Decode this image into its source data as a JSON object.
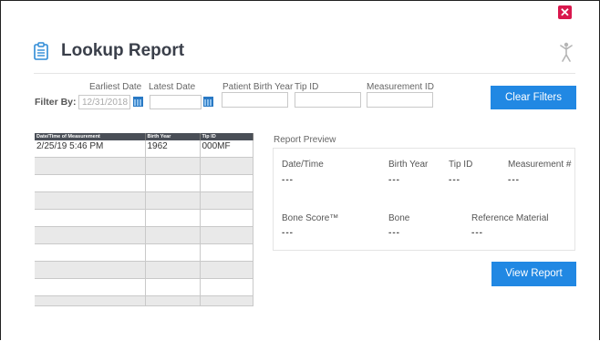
{
  "window": {
    "title": "Lookup Report",
    "close_glyph": "✕",
    "icons": [
      "clipboard-icon",
      "person-icon",
      "close-icon",
      "calendar-icon"
    ],
    "accent_color": "#2188e3",
    "close_color": "#d9184d"
  },
  "filters": {
    "filter_by_label": "Filter By:",
    "earliest_date": {
      "label": "Earliest Date",
      "value": "12/31/2018"
    },
    "latest_date": {
      "label": "Latest Date",
      "value": ""
    },
    "birth_year": {
      "label": "Patient Birth Year",
      "value": ""
    },
    "tip_id": {
      "label": "Tip ID",
      "value": ""
    },
    "measurement_id": {
      "label": "Measurement ID",
      "value": ""
    },
    "clear_label": "Clear Filters"
  },
  "table": {
    "columns": [
      "Date/Time of Measurement",
      "Birth Year",
      "Tip ID"
    ],
    "rows": [
      [
        "2/25/19 5:46 PM",
        "1962",
        "000MF"
      ],
      [
        "",
        "",
        ""
      ],
      [
        "",
        "",
        ""
      ],
      [
        "",
        "",
        ""
      ],
      [
        "",
        "",
        ""
      ],
      [
        "",
        "",
        ""
      ],
      [
        "",
        "",
        ""
      ],
      [
        "",
        "",
        ""
      ],
      [
        "",
        "",
        ""
      ],
      [
        "",
        "",
        ""
      ]
    ]
  },
  "preview": {
    "title": "Report Preview",
    "date_time": {
      "label": "Date/Time",
      "value": "---"
    },
    "birth_year": {
      "label": "Birth Year",
      "value": "---"
    },
    "tip_id": {
      "label": "Tip ID",
      "value": "---"
    },
    "measurement_num": {
      "label": "Measurement #",
      "value": "---"
    },
    "bone_score": {
      "label": "Bone Score™",
      "value": "---"
    },
    "bone": {
      "label": "Bone",
      "value": "---"
    },
    "reference_material": {
      "label": "Reference Material",
      "value": "---"
    },
    "view_label": "View Report"
  }
}
